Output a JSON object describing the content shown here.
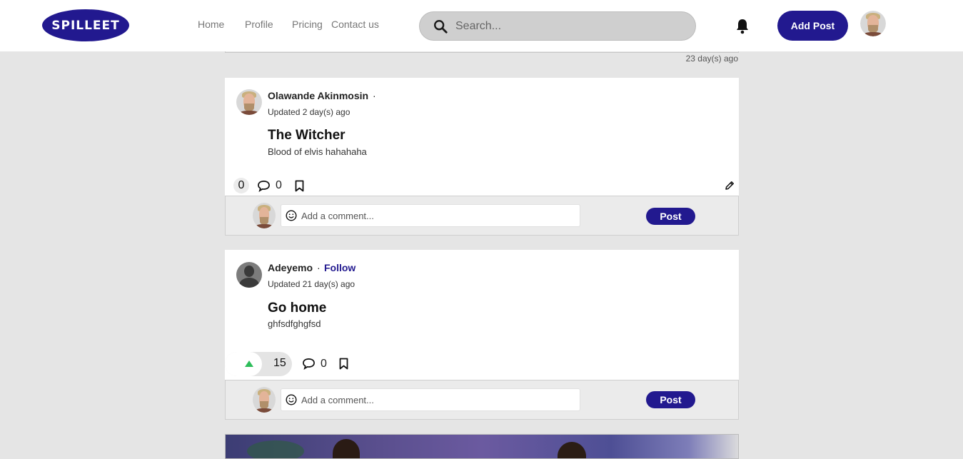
{
  "header": {
    "logo_text": "SPILLEET",
    "nav": [
      {
        "label": "Home"
      },
      {
        "label": "Profile"
      },
      {
        "label": "Pricing"
      },
      {
        "label": "Contact us"
      }
    ],
    "search_placeholder": "Search...",
    "add_post_label": "Add Post",
    "icons": {
      "search": "search-icon",
      "bell": "bell-icon"
    },
    "brand_color": "#22198f"
  },
  "previous_post": {
    "time": "23 day(s) ago"
  },
  "posts": [
    {
      "author": "Olawande Akinmosin",
      "separator": "·",
      "follow": "",
      "updated": "Updated 2 day(s) ago",
      "title": "The Witcher",
      "body": "Blood of elvis hahahaha",
      "votes": "0",
      "comments": "0",
      "comment_placeholder": "Add a comment...",
      "post_button": "Post"
    },
    {
      "author": "Adeyemo",
      "separator": "·",
      "follow": "Follow",
      "updated": "Updated 21 day(s) ago",
      "title": "Go home",
      "body": "ghfsdfghgfsd",
      "votes": "15",
      "comments": "0",
      "comment_placeholder": "Add a comment...",
      "post_button": "Post"
    }
  ]
}
